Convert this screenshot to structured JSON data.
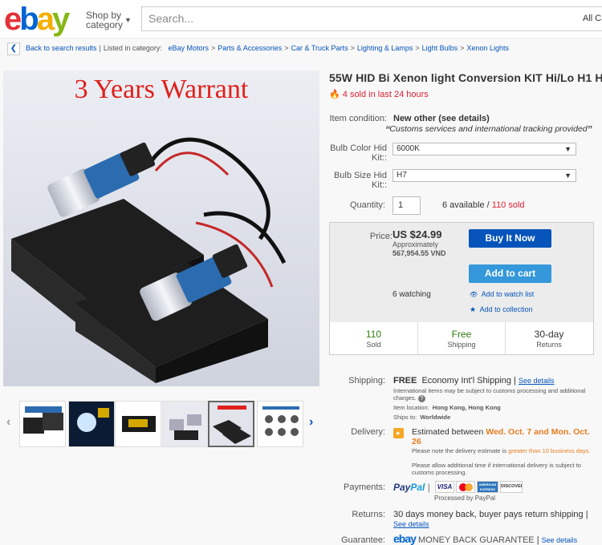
{
  "header": {
    "logo_letters": [
      "e",
      "b",
      "a",
      "y"
    ],
    "logo_colors": [
      "#e53238",
      "#0064d2",
      "#f5af02",
      "#86b817"
    ],
    "shop_by_line1": "Shop by",
    "shop_by_line2": "category",
    "search_placeholder": "Search...",
    "category_select": "All Ca"
  },
  "breadcrumb": {
    "back": "Back to search results",
    "listed_in": "Listed in category:",
    "items": [
      "eBay Motors",
      "Parts & Accessories",
      "Car & Truck Parts",
      "Lighting & Lamps",
      "Light Bulbs",
      "Xenon Lights"
    ]
  },
  "image": {
    "banner": "3 Years Warrant",
    "thumb_count": 6,
    "selected_thumb": 5
  },
  "item": {
    "title": "55W HID Bi Xenon light Conversion KIT Hi/Lo H1 H",
    "sold_recent": "4 sold in last 24 hours",
    "condition_label": "Item condition:",
    "condition_value": "New other (see details)",
    "condition_note": "Customs services and international tracking provided",
    "bulb_color_label": "Bulb Color Hid Kit::",
    "bulb_color_value": "6000K",
    "bulb_size_label": "Bulb Size Hid Kit::",
    "bulb_size_value": "H7",
    "quantity_label": "Quantity:",
    "quantity_value": "1",
    "available": "6 available",
    "sold_total": "110 sold"
  },
  "buybox": {
    "price_label": "Price:",
    "price": "US $24.99",
    "approx_label": "Approximately",
    "approx_value": "567,954.55 VND",
    "buy_now": "Buy It Now",
    "add_to_cart": "Add to cart",
    "watching": "6 watching",
    "watch_list": "Add to watch list",
    "collection": "Add to collection",
    "stats": [
      {
        "value": "110",
        "label": "Sold"
      },
      {
        "value": "Free",
        "label": "Shipping"
      },
      {
        "value": "30-day",
        "label": "Returns"
      }
    ]
  },
  "shipping": {
    "label": "Shipping:",
    "free": "FREE",
    "method": "Economy Int'l Shipping",
    "see_details": "See details",
    "note": "International items may be subject to customs processing and additional charges.",
    "location_label": "Item location:",
    "location": "Hong Kong, Hong Kong",
    "ships_label": "Ships to:",
    "ships_to": "Worldwide"
  },
  "delivery": {
    "label": "Delivery:",
    "estimated": "Estimated between",
    "dates": "Wed. Oct. 7 and Mon. Oct. 26",
    "note1_pre": "Please note the delivery estimate is",
    "note1_hl": "greater than 10 business days.",
    "note2": "Please allow additional time if international delivery is subject to customs processing."
  },
  "payments": {
    "label": "Payments:",
    "paypal": "PayPal",
    "processed": "Processed by PayPal",
    "cards": [
      "VISA",
      "",
      "AMERICAN EXPRESS",
      "DISCOVER"
    ]
  },
  "returns": {
    "label": "Returns:",
    "text": "30 days money back, buyer pays return shipping |",
    "see_details": "See details"
  },
  "guarantee": {
    "label": "Guarantee:",
    "ebay": "ebay",
    "text": "MONEY BACK GUARANTEE",
    "see_details": "See details"
  },
  "colors": {
    "link": "#0654ba",
    "red": "#dd1e31",
    "buy_now": "#0654ba",
    "add_cart": "#3498db",
    "green": "#2e7d11"
  }
}
